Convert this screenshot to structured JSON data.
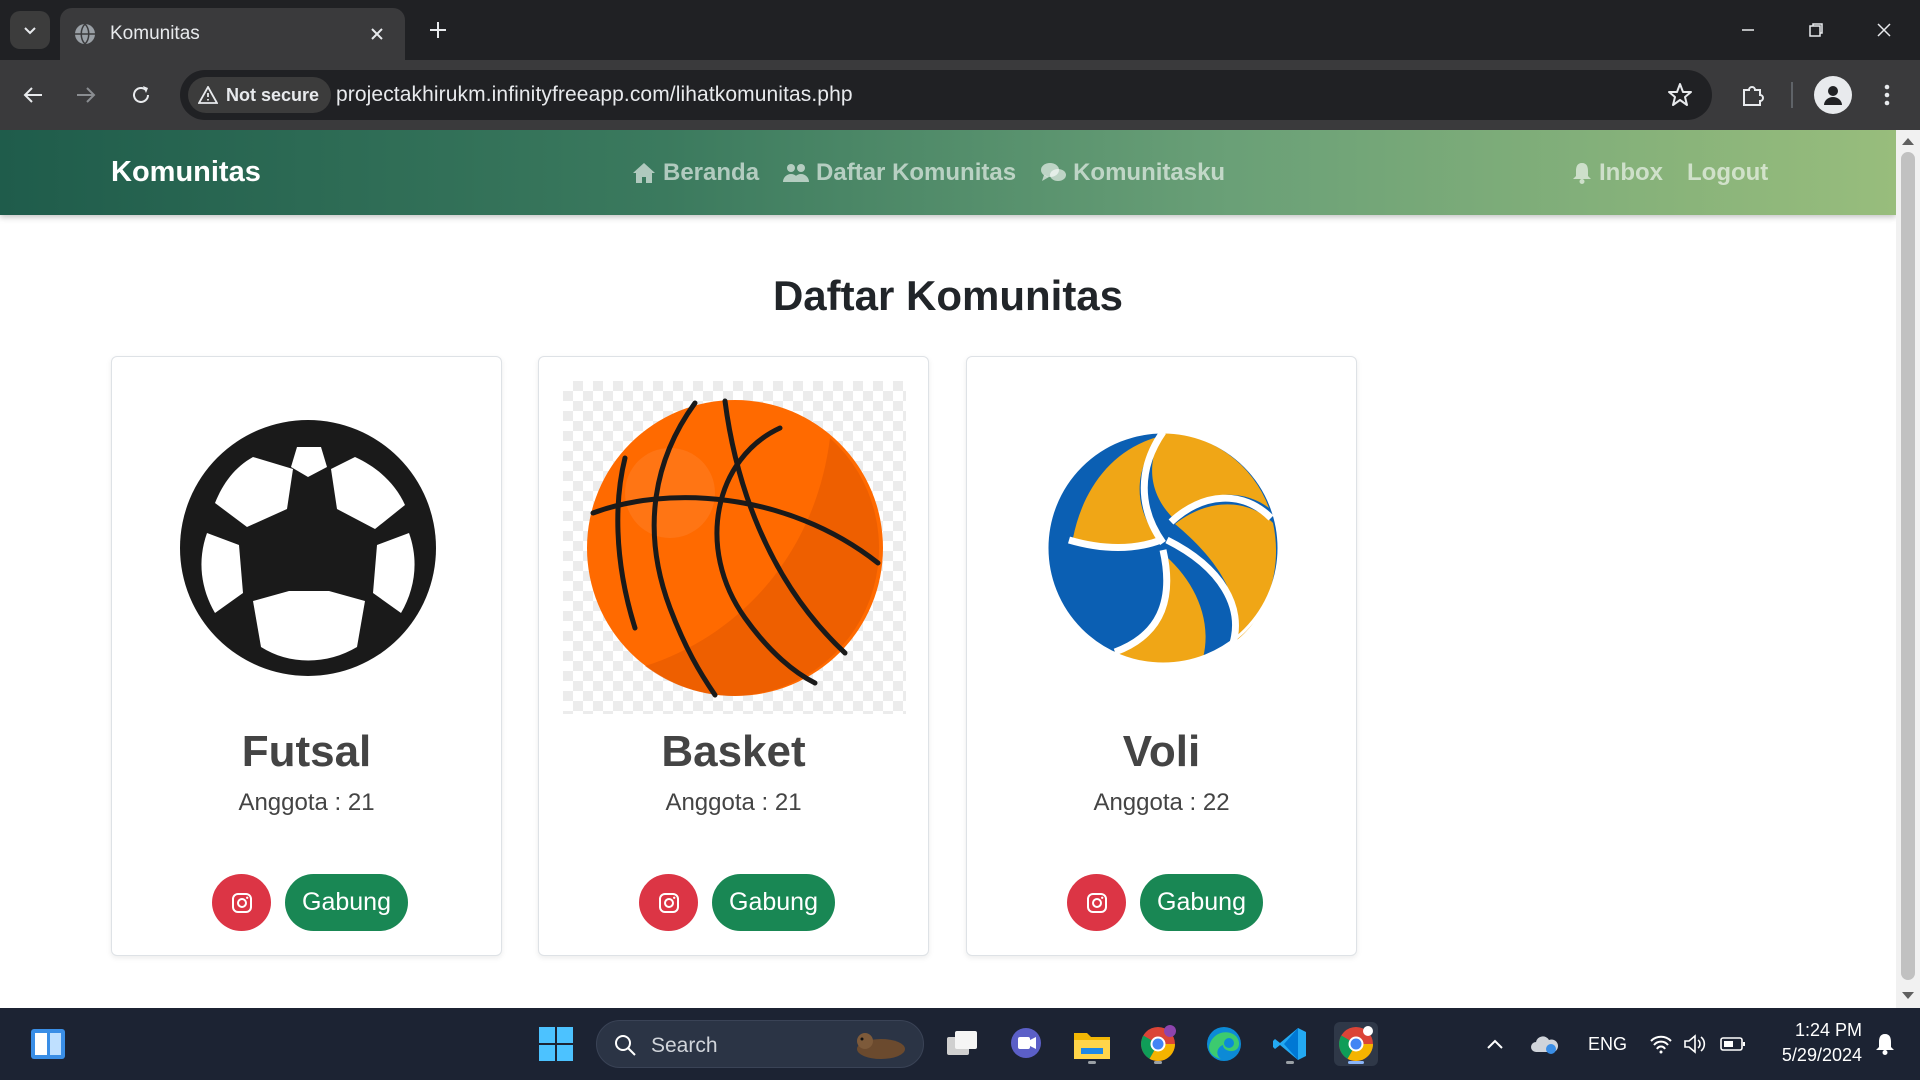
{
  "browser": {
    "tab_title": "Komunitas",
    "security_label": "Not secure",
    "url": "projectakhirukm.infinityfreeapp.com/lihatkomunitas.php"
  },
  "site": {
    "brand": "Komunitas",
    "nav": {
      "beranda": "Beranda",
      "daftar_komunitas": "Daftar Komunitas",
      "komunitasku": "Komunitasku",
      "inbox": "Inbox",
      "logout": "Logout"
    },
    "heading": "Daftar Komunitas",
    "cards": [
      {
        "name": "Futsal",
        "members": "Anggota : 21",
        "join_label": "Gabung",
        "image": "soccer-ball"
      },
      {
        "name": "Basket",
        "members": "Anggota : 21",
        "join_label": "Gabung",
        "image": "basketball"
      },
      {
        "name": "Voli",
        "members": "Anggota : 22",
        "join_label": "Gabung",
        "image": "volleyball"
      }
    ],
    "colors": {
      "instagram_button": "#dc3545",
      "join_button": "#198754",
      "nav_gradient_start": "#1f5c4b",
      "nav_gradient_end": "#98bd7c"
    }
  },
  "taskbar": {
    "search_placeholder": "Search",
    "language": "ENG",
    "time": "1:24 PM",
    "date": "5/29/2024"
  }
}
